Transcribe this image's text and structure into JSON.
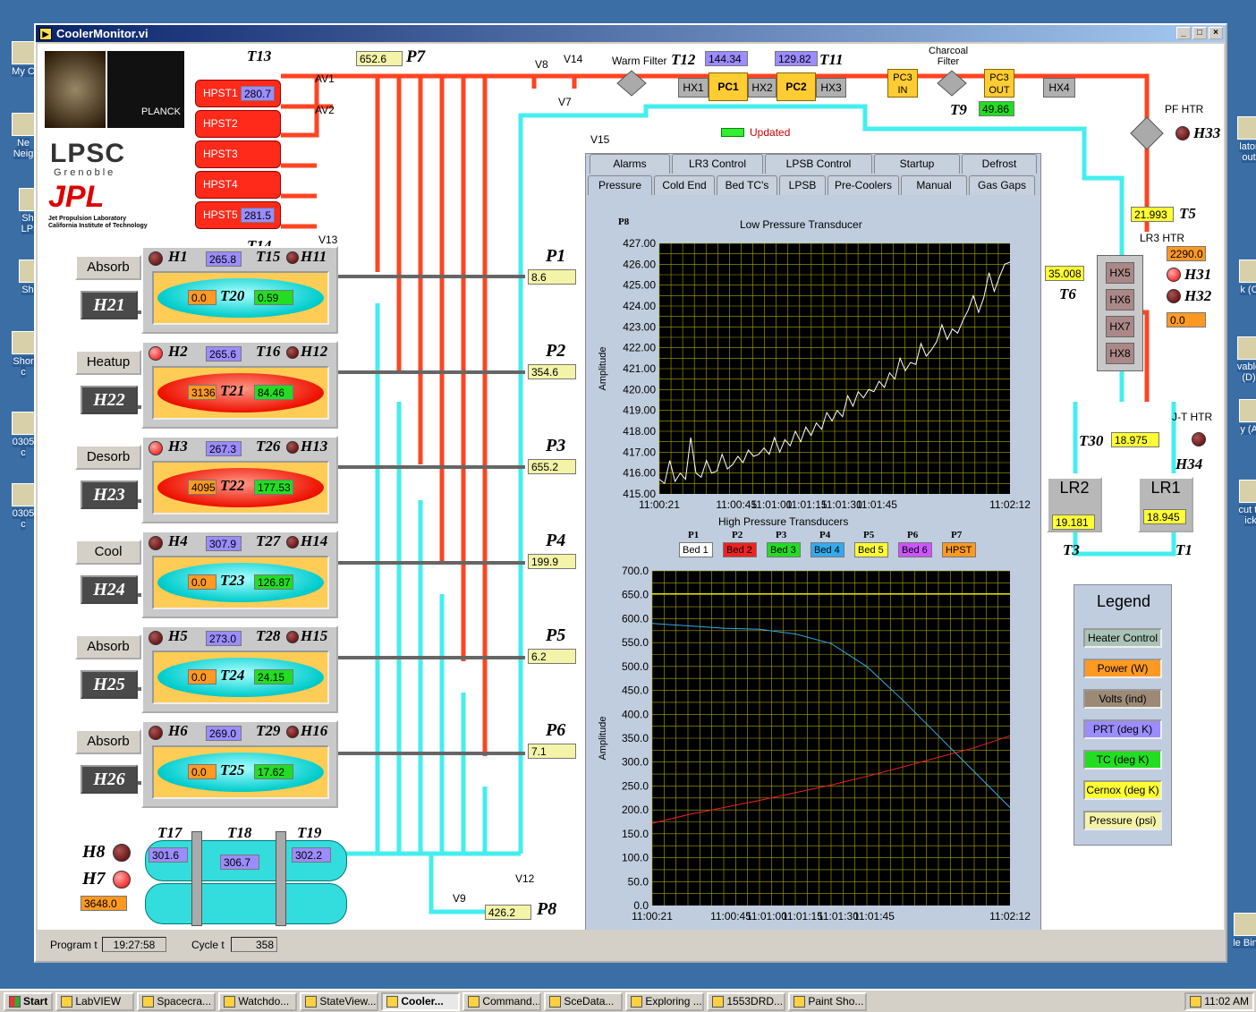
{
  "window": {
    "title": "CoolerMonitor.vi"
  },
  "desktop_icons": [
    "My C",
    "Ne\nNeig",
    "Sho\nLPS",
    "Sho",
    "Shor\nc",
    "0305\nc",
    "0305\nc",
    "lator\nout",
    "k (C:",
    "vable\n(D)",
    "y (A)",
    "cut to\nick",
    "le Bin"
  ],
  "logos": {
    "lpsc": "LPSC",
    "grenoble": "Grenoble",
    "jpl": "JPL",
    "jpl_sub": "Jet Propulsion Laboratory\nCalifornia Institute of Technology",
    "planck": "PLANCK"
  },
  "hpst": [
    {
      "name": "HPST1",
      "value": "280.7"
    },
    {
      "name": "HPST2",
      "value": ""
    },
    {
      "name": "HPST3",
      "value": ""
    },
    {
      "name": "HPST4",
      "value": ""
    },
    {
      "name": "HPST5",
      "value": "281.5"
    }
  ],
  "top_labels": {
    "t13": "T13",
    "t14": "T14",
    "av1": "AV1",
    "av2": "AV2",
    "v13": "V13",
    "p7": "P7",
    "p7_value": "652.6",
    "v8": "V8",
    "v14": "V14",
    "v7": "V7",
    "v15": "V15",
    "warm_filter": "Warm Filter",
    "t12": "T12",
    "t12_value": "144.34",
    "t11": "T11",
    "t11_value": "129.82",
    "hx1": "HX1",
    "pc1": "PC1",
    "hx2": "HX2",
    "pc2": "PC2",
    "hx3": "HX3",
    "pc3in": "PC3\nIN",
    "charcoal": "Charcoal\nFilter",
    "pc3out": "PC3\nOUT",
    "t9": "T9",
    "t9_value": "49.86",
    "hx4": "HX4",
    "updated": "Updated",
    "pf_htr": "PF HTR",
    "h33": "H33"
  },
  "beds": [
    {
      "mode": "Absorb",
      "h": "H1",
      "prt": "265.8",
      "tt": "T15",
      "hh": "H11",
      "power": "0.0",
      "tb": "T20",
      "tc": "0.59",
      "btn": "H21",
      "p": "P1",
      "pv": "8.6",
      "hot": false,
      "led": "off"
    },
    {
      "mode": "Heatup",
      "h": "H2",
      "prt": "265.6",
      "tt": "T16",
      "hh": "H12",
      "power": "3136.0",
      "tb": "T21",
      "tc": "84.46",
      "btn": "H22",
      "p": "P2",
      "pv": "354.6",
      "hot": true,
      "led": "on"
    },
    {
      "mode": "Desorb",
      "h": "H3",
      "prt": "267.3",
      "tt": "T26",
      "hh": "H13",
      "power": "4095.0",
      "tb": "T22",
      "tc": "177.53",
      "btn": "H23",
      "p": "P3",
      "pv": "655.2",
      "hot": true,
      "led": "on"
    },
    {
      "mode": "Cool",
      "h": "H4",
      "prt": "307.9",
      "tt": "T27",
      "hh": "H14",
      "power": "0.0",
      "tb": "T23",
      "tc": "126.87",
      "btn": "H24",
      "p": "P4",
      "pv": "199.9",
      "hot": false,
      "led": "off"
    },
    {
      "mode": "Absorb",
      "h": "H5",
      "prt": "273.0",
      "tt": "T28",
      "hh": "H15",
      "power": "0.0",
      "tb": "T24",
      "tc": "24.15",
      "btn": "H25",
      "p": "P5",
      "pv": "6.2",
      "hot": false,
      "led": "off"
    },
    {
      "mode": "Absorb",
      "h": "H6",
      "prt": "269.0",
      "tt": "T29",
      "hh": "H16",
      "power": "0.0",
      "tb": "T25",
      "tc": "17.62",
      "btn": "H26",
      "p": "P6",
      "pv": "7.1",
      "hot": false,
      "led": "off"
    }
  ],
  "lower": {
    "t17": "T17",
    "t17_value": "301.6",
    "t18": "T18",
    "t18_value": "306.7",
    "t19": "T19",
    "t19_value": "302.2",
    "h8": "H8",
    "h7": "H7",
    "h7_value": "3648.0",
    "v9": "V9",
    "v12": "V12",
    "p8": "P8",
    "p8_value": "426.2"
  },
  "tabs_row1": [
    "Alarms",
    "LR3 Control",
    "LPSB Control",
    "Startup",
    "Defrost"
  ],
  "tabs_row2": [
    "Pressure",
    "Cold End",
    "Bed TC's",
    "LPSB",
    "Pre-Coolers",
    "Manual",
    "Gas Gaps"
  ],
  "right": {
    "t5": "T5",
    "t5_value": "21.993",
    "lr3_htr": "LR3 HTR",
    "lr3_value": "2290.0",
    "t6": "T6",
    "t6_value": "35.008",
    "hx5": "HX5",
    "hx6": "HX6",
    "hx7": "HX7",
    "hx8": "HX8",
    "h31": "H31",
    "h32": "H32",
    "h32_value": "0.0",
    "t30": "T30",
    "t30_value": "18.975",
    "jt_htr": "J-T HTR",
    "h34": "H34",
    "lr2": "LR2",
    "lr2_value": "19.181",
    "lr1": "LR1",
    "lr1_value": "18.945",
    "t3": "T3",
    "t1": "T1"
  },
  "legend": {
    "title": "Legend",
    "items": [
      {
        "label": "Heater Control",
        "color": "#a9c3b6"
      },
      {
        "label": "Power (W)",
        "color": "#ff9922"
      },
      {
        "label": "Volts (ind)",
        "color": "#9c8a76"
      },
      {
        "label": "PRT (deg K)",
        "color": "#9b8cff"
      },
      {
        "label": "TC (deg K)",
        "color": "#22dd22"
      },
      {
        "label": "Cernox (deg K)",
        "color": "#ffff33"
      },
      {
        "label": "Pressure (psi)",
        "color": "#f4f4a8"
      }
    ]
  },
  "status": {
    "program_label": "Program t",
    "program_value": "19:27:58",
    "cycle_label": "Cycle t",
    "cycle_value": "358"
  },
  "taskbar": {
    "start": "Start",
    "items": [
      "LabVIEW",
      "Spacecra...",
      "Watchdo...",
      "StateView...",
      "Cooler...",
      "Command...",
      "SceData...",
      "Exploring ...",
      "1553DRD...",
      "Paint Sho..."
    ],
    "active": 4,
    "clock": "11:02 AM"
  },
  "chart_data": [
    {
      "type": "line",
      "title": "Low Pressure Transducer",
      "corner_label": "P8",
      "ylabel": "Amplitude",
      "xlabel": "",
      "ylim": [
        415,
        427
      ],
      "yticks": [
        "427.00",
        "426.00",
        "425.00",
        "424.00",
        "423.00",
        "422.00",
        "421.00",
        "420.00",
        "419.00",
        "418.00",
        "417.00",
        "416.00",
        "415.00"
      ],
      "xticks": [
        "11:00:21",
        "11:00:45",
        "11:01:00",
        "11:01:15",
        "11:01:30",
        "11:01:45",
        "11:02:12"
      ],
      "grid": true,
      "series": [
        {
          "color": "#ffffff",
          "values": [
            415.7,
            415.5,
            416.6,
            415.6,
            416.0,
            415.7,
            417.7,
            416.0,
            415.8,
            416.6,
            416.0,
            416.1,
            416.9,
            416.2,
            416.4,
            416.8,
            416.5,
            417.1,
            416.8,
            416.9,
            417.2,
            416.9,
            417.7,
            417.0,
            417.6,
            417.3,
            418.0,
            417.5,
            418.2,
            417.8,
            418.4,
            418.1,
            418.9,
            418.5,
            419.0,
            418.7,
            419.7,
            419.2,
            419.9,
            419.6,
            420.0,
            419.9,
            420.4,
            420.1,
            420.8,
            420.5,
            421.5,
            420.9,
            421.3,
            421.2,
            422.2,
            421.6,
            421.9,
            422.3,
            423.1,
            422.4,
            422.9,
            422.7,
            423.3,
            423.8,
            424.5,
            423.7,
            424.4,
            425.6,
            424.7,
            425.4,
            426.0,
            426.1
          ]
        }
      ]
    },
    {
      "type": "line",
      "title": "High Pressure Transducers",
      "ylabel": "Amplitude",
      "xlabel": "",
      "ylim": [
        0,
        700
      ],
      "yticks": [
        "700.0",
        "650.0",
        "600.0",
        "550.0",
        "500.0",
        "450.0",
        "400.0",
        "350.0",
        "300.0",
        "250.0",
        "200.0",
        "150.0",
        "100.0",
        "50.0",
        "0.0"
      ],
      "xticks": [
        "11:00:21",
        "11:00:45",
        "11:01:00",
        "11:01:15",
        "11:01:30",
        "11:01:45",
        "11:02:12"
      ],
      "grid": true,
      "legend": [
        {
          "tag": "P1",
          "name": "Bed 1",
          "color": "#ffffff"
        },
        {
          "tag": "P2",
          "name": "Bed 2",
          "color": "#ee2222"
        },
        {
          "tag": "P3",
          "name": "Bed 3",
          "color": "#22dd22"
        },
        {
          "tag": "P4",
          "name": "Bed 4",
          "color": "#33aaee"
        },
        {
          "tag": "P5",
          "name": "Bed 5",
          "color": "#ffff33"
        },
        {
          "tag": "P6",
          "name": "Bed 6",
          "color": "#cc55ff"
        },
        {
          "tag": "P7",
          "name": "HPST",
          "color": "#ff9922"
        }
      ],
      "series": [
        {
          "name": "HPST",
          "color": "#ffff00",
          "values": [
            652,
            652,
            652,
            652,
            652,
            652,
            652,
            652,
            652,
            652,
            652
          ]
        },
        {
          "name": "Bed 4",
          "color": "#33aaee",
          "values": [
            590,
            585,
            580,
            578,
            568,
            548,
            500,
            430,
            355,
            280,
            205
          ]
        },
        {
          "name": "Bed 2",
          "color": "#ee2222",
          "values": [
            172,
            190,
            205,
            220,
            236,
            252,
            270,
            290,
            310,
            330,
            355
          ]
        }
      ]
    }
  ]
}
